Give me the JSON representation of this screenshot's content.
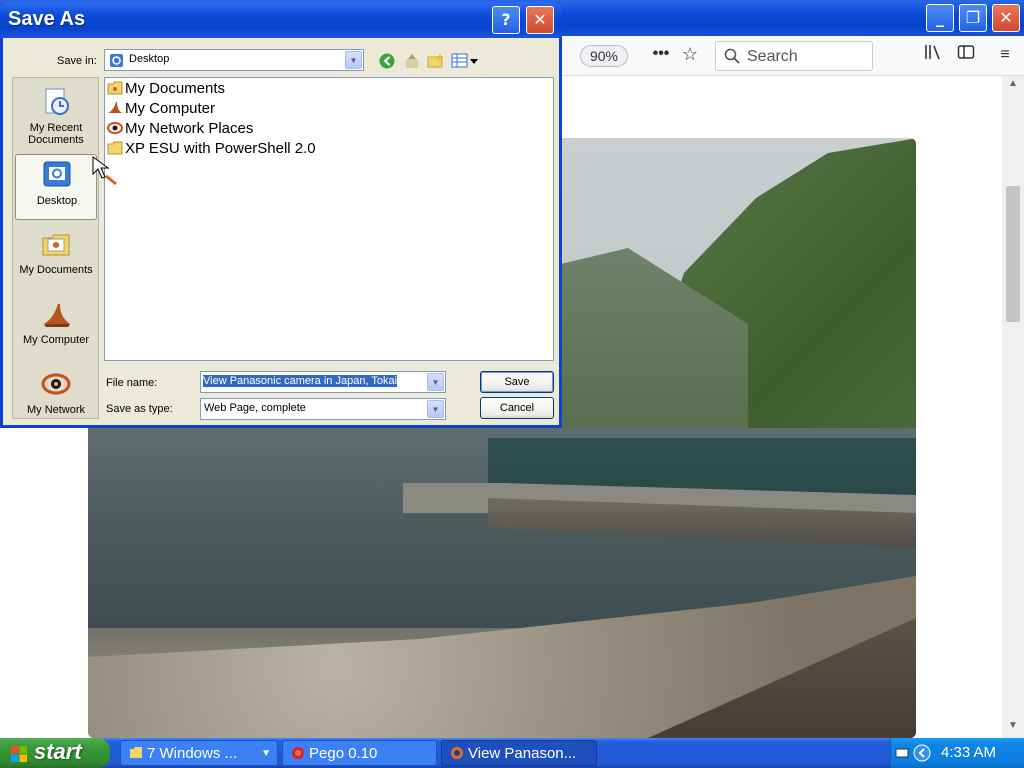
{
  "browser": {
    "zoom": "90%",
    "search_placeholder": "Search"
  },
  "dialog": {
    "title": "Save As",
    "help_label": "?",
    "close_label": "✕",
    "save_in_label": "Save in:",
    "save_in_value": "Desktop",
    "places": [
      {
        "label_line1": "My Recent",
        "label_line2": "Documents"
      },
      {
        "label_line1": "Desktop",
        "label_line2": ""
      },
      {
        "label_line1": "My Documents",
        "label_line2": ""
      },
      {
        "label_line1": "My Computer",
        "label_line2": ""
      },
      {
        "label_line1": "My Network",
        "label_line2": ""
      }
    ],
    "files": [
      {
        "name": "My Documents",
        "icon": "my-documents-icon"
      },
      {
        "name": "My Computer",
        "icon": "my-computer-icon"
      },
      {
        "name": "My Network Places",
        "icon": "network-places-icon"
      },
      {
        "name": "XP ESU with PowerShell 2.0",
        "icon": "folder-icon"
      }
    ],
    "file_name_label": "File name:",
    "file_name_value": "View Panasonic camera in Japan, Tokai",
    "save_type_label": "Save as type:",
    "save_type_value": "Web Page, complete",
    "save_button": "Save",
    "cancel_button": "Cancel"
  },
  "taskbar": {
    "start_label": "start",
    "tasks": [
      {
        "label": "7 Windows ..."
      },
      {
        "label": "Pego 0.10"
      },
      {
        "label": "View Panason..."
      }
    ],
    "clock": "4:33 AM"
  },
  "colors": {
    "xp_blue": "#0a4ad6",
    "start_green": "#3b9a3b",
    "dialog_bg": "#ece9d8"
  }
}
